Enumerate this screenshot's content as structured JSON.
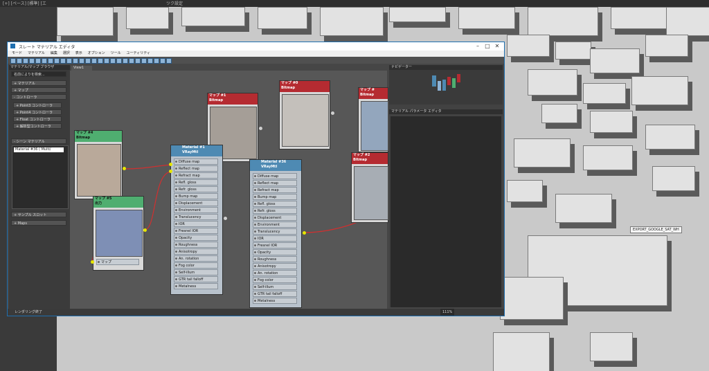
{
  "viewport": {
    "label_left": "[+] [ペース] [標準] [エ",
    "label_right": "ツク設定",
    "export_label": "EXPORT_GOOGLE_SAT_WH"
  },
  "window": {
    "title": "スレート マテリアル エディタ",
    "menu": [
      "モード",
      "マテリアル",
      "編集",
      "選択",
      "表示",
      "オプション",
      "ツール",
      "ユーティリティ"
    ],
    "controls": {
      "minimize": "–",
      "maximize": "□",
      "close": "✕"
    }
  },
  "left_panel": {
    "header": "マテリアル/マップ ブラウザ",
    "search": "名前によりを検索...",
    "sections": [
      "+ マテリアル",
      "+ マップ",
      "- コントローラ"
    ],
    "controllers": [
      "+ Point3 コントローラ",
      "+ Point4 コントローラ",
      "+ Float コントローラ",
      "+ 解析型コントローラ"
    ],
    "scene_header": "- シーン マテリアル",
    "scene_item": "Material #36 ( Multi/",
    "sample_slots": "+ サンプル スロット",
    "maps": "+ Maps"
  },
  "view_tab": "View1",
  "right_panel": {
    "navigator": "ナビゲーター",
    "param_editor": "マテリアル パラメータ エディタ"
  },
  "status": {
    "text": "レンダリング終了",
    "zoom": "111%"
  },
  "nodes": {
    "map4": {
      "title": "マップ #4",
      "sub": "Bitmap"
    },
    "map5": {
      "title": "マップ #5",
      "sub": "出力",
      "slot": "マップ"
    },
    "map1": {
      "title": "マップ #1",
      "sub": "Bitmap"
    },
    "map0": {
      "title": "マップ #0",
      "sub": "Bitmap"
    },
    "map_tr": {
      "title": "マップ #",
      "sub": "Bitmap"
    },
    "map2": {
      "title": "マップ #2",
      "sub": "Bitmap"
    },
    "mat1": {
      "title": "Material #1",
      "sub": "VRayMtl"
    },
    "mat36": {
      "title": "Material #36",
      "sub": "VRayMtl"
    }
  },
  "slots_mat1": [
    "Diffuse map",
    "Reflect map",
    "Refract map",
    "Refl. gloss",
    "Refr. gloss",
    "Bump map",
    "Displacement",
    "Environment",
    "Translucency",
    "IOR",
    "Fresnel IOR",
    "Opacity",
    "Roughness",
    "Anisotropy",
    "An. rotation",
    "Fog color",
    "Self-illum",
    "GTR tail falloff",
    "Metalness"
  ],
  "slots_mat36": [
    "Diffuse map",
    "Reflect map",
    "Refract map",
    "Bump map",
    "Refl. gloss",
    "Refr. gloss",
    "Displacement",
    "Environment",
    "Translucency",
    "IOR",
    "Fresnel IOR",
    "Opacity",
    "Roughness",
    "Anisotropy",
    "An. rotation",
    "Fog color",
    "Self-illum",
    "GTR tail falloff",
    "Metalness"
  ],
  "colors": {
    "accent": "#1e6fb0",
    "wire": "#d03030",
    "pin": "#e6e600",
    "map_header": "#4fae70",
    "bitmap_header": "#b52b31"
  }
}
